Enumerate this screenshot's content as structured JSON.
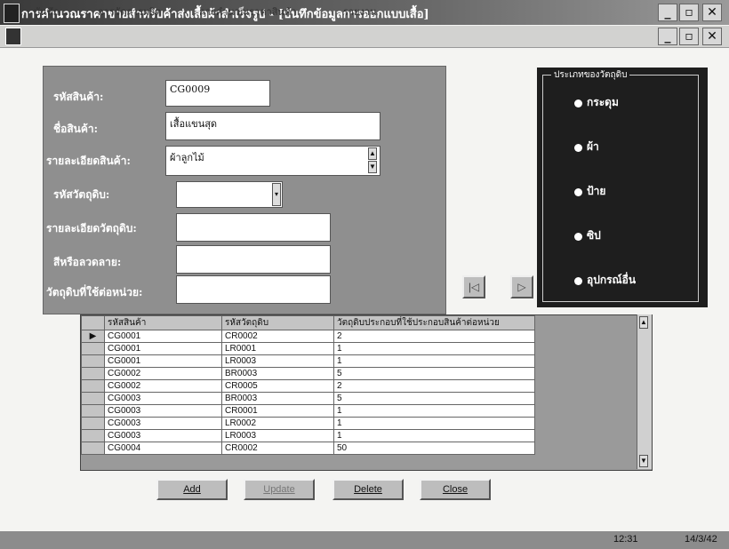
{
  "window": {
    "title": "การคำนวณราคาขายสำหรับค้าส่งเสื้อผ้าสำเร็จรูป - [บันทึกข้อมูลการออกแบบเสื้อ]",
    "controls": [
      "_",
      "▫",
      "✕"
    ]
  },
  "menu": {
    "items": [
      "บันทึก",
      "การจัดการผลิต",
      "การคำนวณราคาสินค้า",
      "รายงาน"
    ]
  },
  "form": {
    "product_code_label": "รหัสสินค้า:",
    "product_code_value": "CG0009",
    "product_name_label": "ชื่อสินค้า:",
    "product_name_value": "เสื้อแขนสุด",
    "product_detail_label": "รายละเอียดสินค้า:",
    "product_detail_value": "ผ้าลูกไม้",
    "material_code_label": "รหัสวัตถุดิบ:",
    "material_code_value": "",
    "material_detail_label": "รายละเอียดวัตถุดิบ:",
    "material_detail_value": "",
    "color_label": "สีหรือลวดลาย:",
    "color_value": "",
    "material_per_unit_label": "วัตถุดิบที่ใช้ต่อหน่วย:",
    "material_per_unit_value": ""
  },
  "nav": {
    "prev_icon": "first-record-icon",
    "next_icon": "next-record-icon"
  },
  "material_type": {
    "legend": "ประเภทของวัตถุดิบ",
    "options": [
      "กระดุม",
      "ผ้า",
      "ป้าย",
      "ซิป",
      "อุปกรณ์อื่น"
    ]
  },
  "grid": {
    "columns": [
      "รหัสสินค้า",
      "รหัสวัตถุดิบ",
      "วัตถุดิบประกอบที่ใช้ประกอบสินค้าต่อหน่วย"
    ],
    "rows": [
      [
        "CG0001",
        "CR0002",
        "2"
      ],
      [
        "CG0001",
        "LR0001",
        "1"
      ],
      [
        "CG0001",
        "LR0003",
        "1"
      ],
      [
        "CG0002",
        "BR0003",
        "5"
      ],
      [
        "CG0002",
        "CR0005",
        "2"
      ],
      [
        "CG0003",
        "BR0003",
        "5"
      ],
      [
        "CG0003",
        "CR0001",
        "1"
      ],
      [
        "CG0003",
        "LR0002",
        "1"
      ],
      [
        "CG0003",
        "LR0003",
        "1"
      ],
      [
        "CG0004",
        "CR0002",
        "50"
      ]
    ],
    "current_row_marker": "▶"
  },
  "buttons": {
    "add": "Add",
    "update": "Update",
    "delete": "Delete",
    "close": "Close"
  },
  "status": {
    "time": "12:31",
    "date": "14/3/42"
  }
}
